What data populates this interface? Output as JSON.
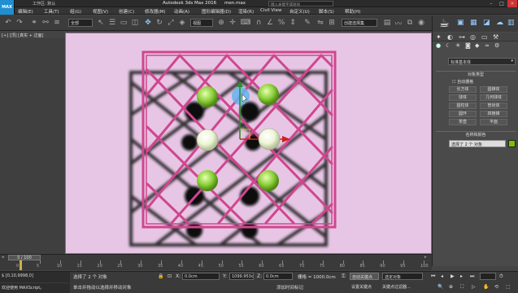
{
  "titlebar": {
    "workspace": "工作区: 默认",
    "app_title": "Autodesk 3ds Max 2016",
    "file": "men.max",
    "search_placeholder": "键入关键字或短语"
  },
  "menubar": {
    "items": [
      "编辑(E)",
      "工具(T)",
      "组(G)",
      "视图(V)",
      "创建(C)",
      "修改器(M)",
      "动画(A)",
      "图形编辑器(D)",
      "渲染(R)",
      "Civil View",
      "自定义(U)",
      "脚本(S)",
      "帮助(H)"
    ]
  },
  "toolbar": {
    "filter_label": "全部",
    "view_label": "视图",
    "selection_set": "创建选择集"
  },
  "viewport": {
    "label": "[+] [顶] [真实 + 边面]"
  },
  "rightpanel": {
    "object_dropdown": "标准基本体",
    "rollout_object_type": "对象类型",
    "autogrid": "自动栅格",
    "buttons": [
      "长方体",
      "圆锥体",
      "球体",
      "几何球体",
      "圆柱体",
      "管状体",
      "圆环",
      "四棱锥",
      "茶壶",
      "平面"
    ],
    "rollout_name_color": "名称和颜色",
    "name_value": "选择了 2 个 对象",
    "swatch_color": "#7fbf00"
  },
  "timeline": {
    "frame": "0 / 100",
    "ticks": [
      "0",
      "5",
      "10",
      "15",
      "20",
      "25",
      "30",
      "35",
      "40",
      "45",
      "50",
      "55",
      "60",
      "65",
      "70",
      "75",
      "80",
      "85",
      "90",
      "95",
      "100"
    ]
  },
  "status": {
    "selected": "选择了 2 个 对象",
    "hint": "单击并拖动以选择并移动对象",
    "x_label": "X:",
    "x_value": "0.0cm",
    "y_label": "Y:",
    "y_value": "1099.953c",
    "z_label": "Z:",
    "z_value": "0.0cm",
    "grid": "栅格 = 1000.0cm",
    "autokey": "自动关键点",
    "selected_obj": "选定对象",
    "setkey": "设置关键点",
    "keyfilter": "关键点过滤器...",
    "maxscript": "欢迎使用 MAXScript。",
    "coords": "$ [0,10,9998,0]",
    "add_time_tag": "添加时间标记"
  }
}
